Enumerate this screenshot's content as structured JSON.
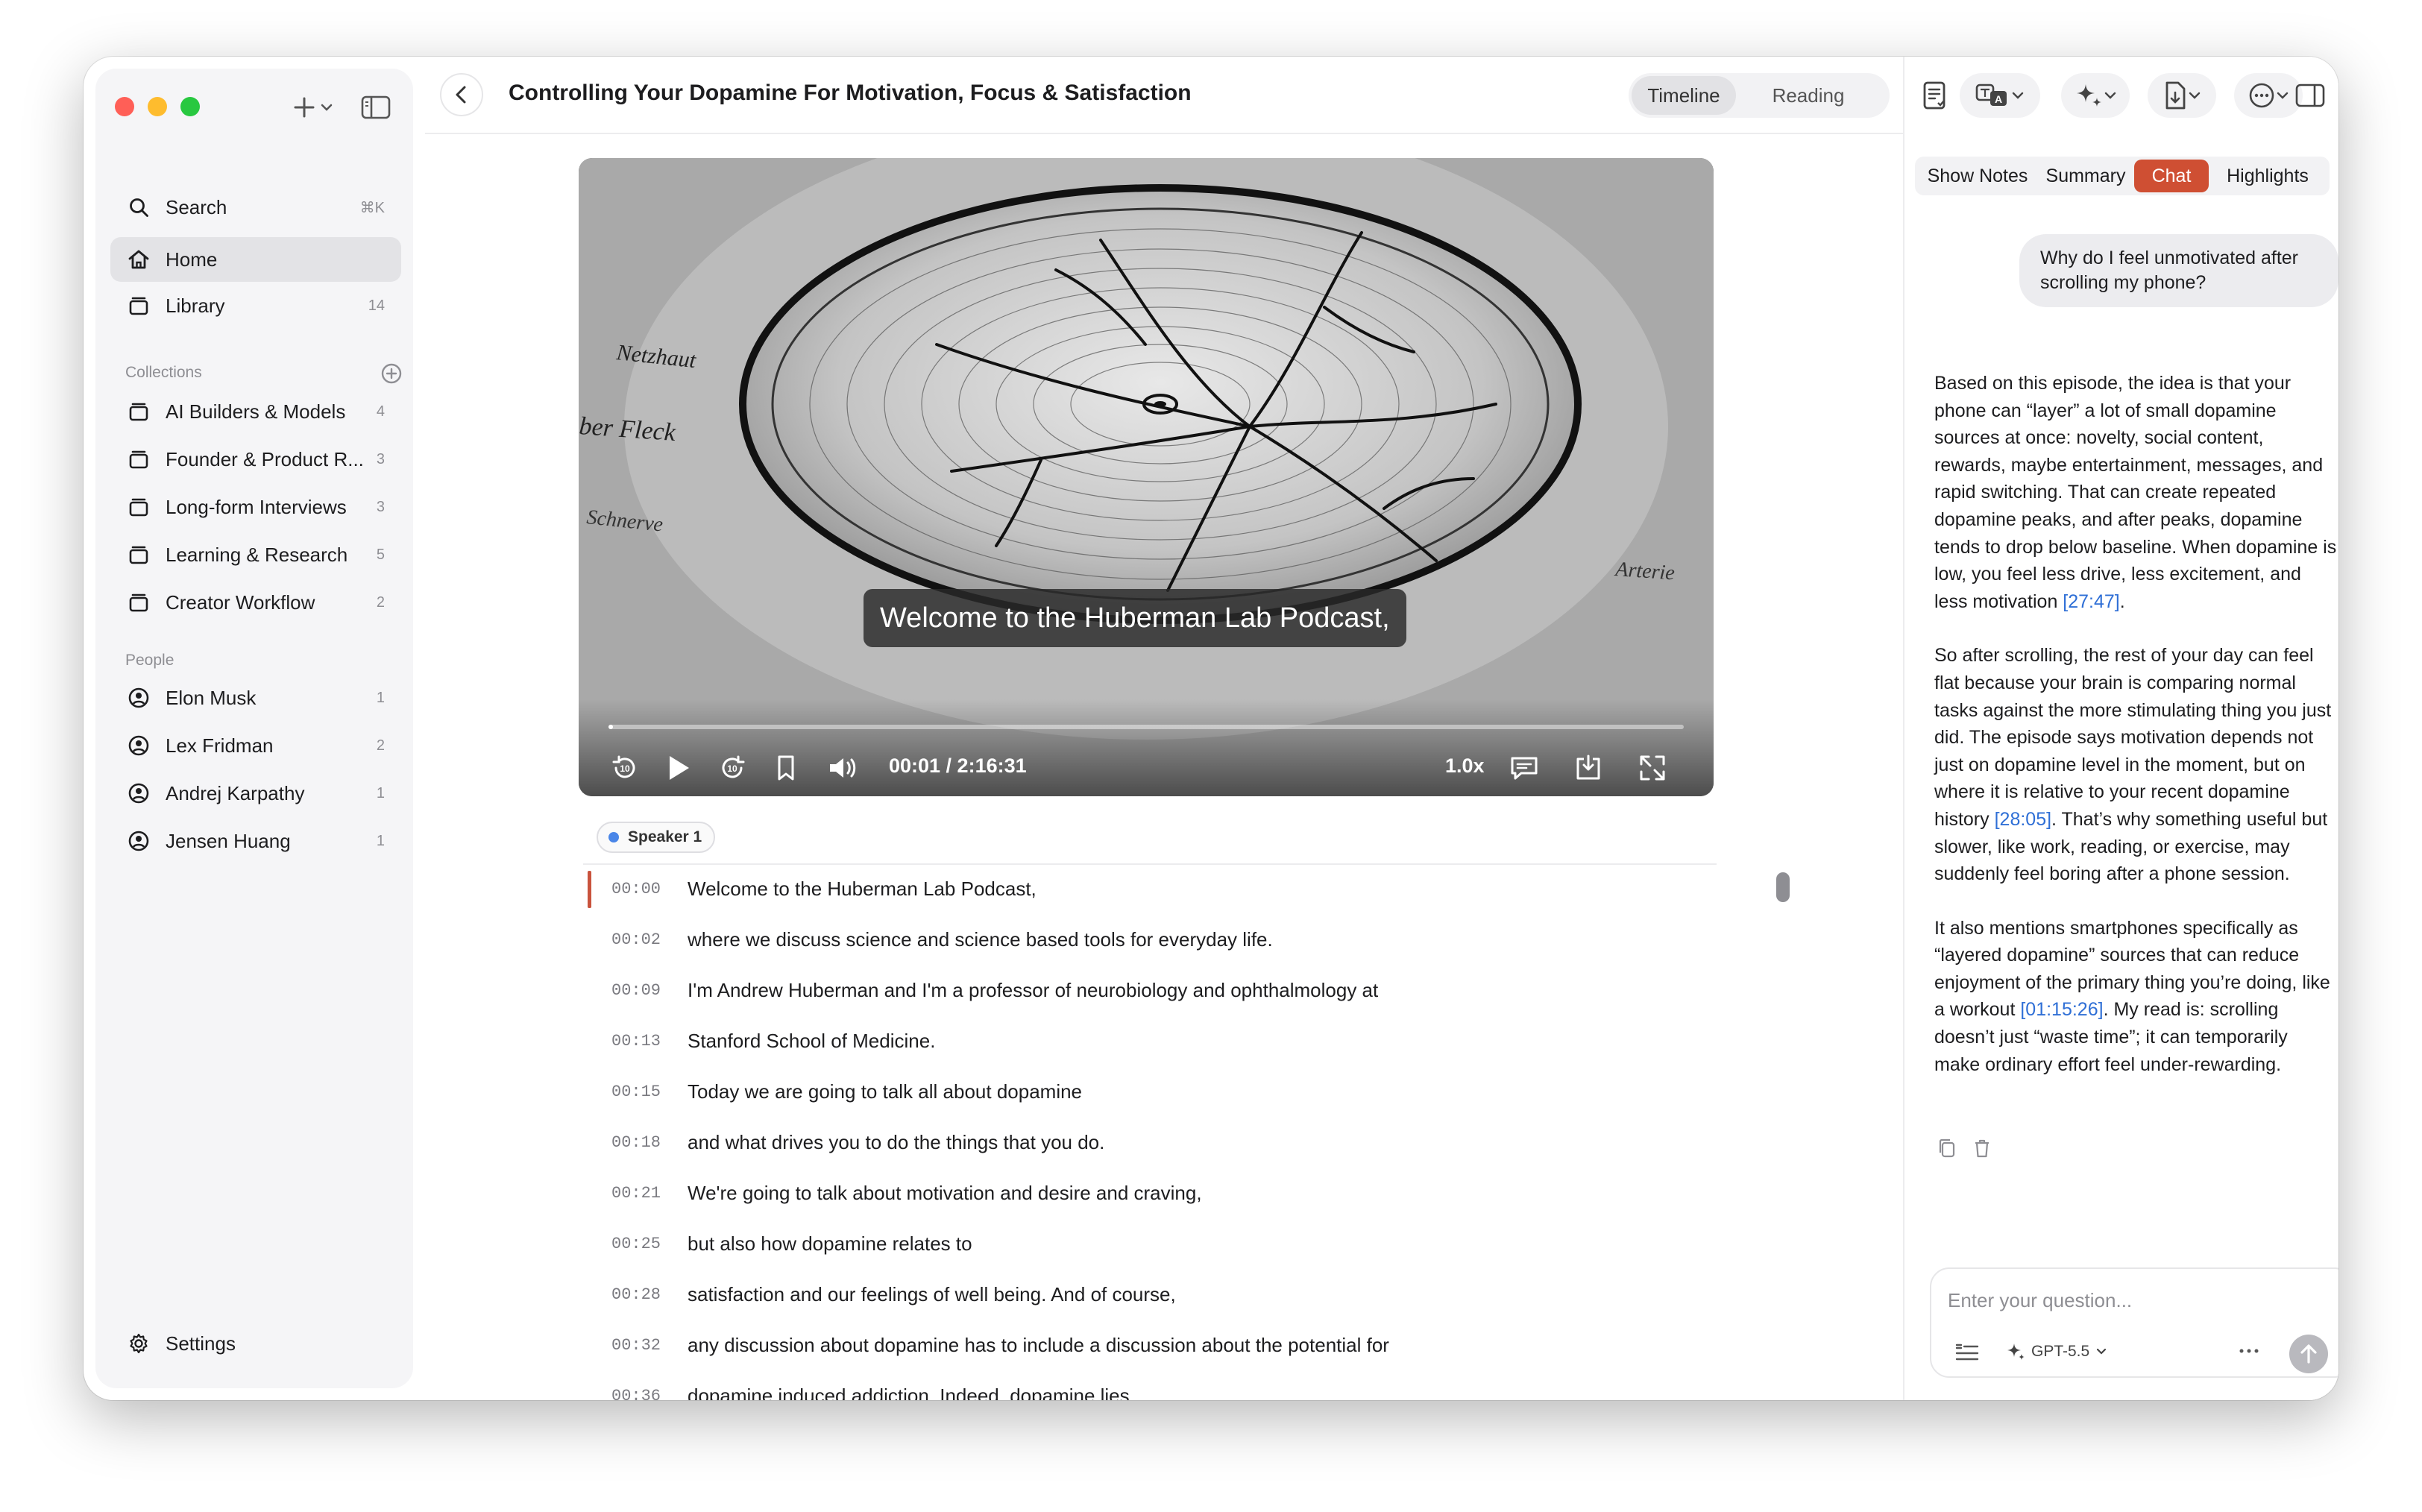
{
  "sidebar": {
    "search_label": "Search",
    "search_shortcut": "⌘K",
    "home_label": "Home",
    "library_label": "Library",
    "library_count": "14",
    "collections_heading": "Collections",
    "collections": [
      {
        "label": "AI Builders & Models",
        "count": "4"
      },
      {
        "label": "Founder & Product R...",
        "count": "3"
      },
      {
        "label": "Long-form Interviews",
        "count": "3"
      },
      {
        "label": "Learning & Research",
        "count": "5"
      },
      {
        "label": "Creator Workflow",
        "count": "2"
      }
    ],
    "people_heading": "People",
    "people": [
      {
        "label": "Elon Musk",
        "count": "1"
      },
      {
        "label": "Lex Fridman",
        "count": "2"
      },
      {
        "label": "Andrej Karpathy",
        "count": "1"
      },
      {
        "label": "Jensen Huang",
        "count": "1"
      }
    ],
    "settings_label": "Settings"
  },
  "header": {
    "title": "Controlling Your Dopamine For Motivation, Focus & Satisfaction",
    "view_tabs": [
      "Timeline",
      "Reading"
    ],
    "active_view": "Timeline"
  },
  "player": {
    "caption": "Welcome to the Huberman Lab Podcast,",
    "time": "00:01 / 2:16:31",
    "speed": "1.0x",
    "progress_fraction": 0.0001
  },
  "speaker_label": "Speaker 1",
  "transcript": [
    {
      "time": "00:00",
      "text": "Welcome to the Huberman Lab Podcast,"
    },
    {
      "time": "00:02",
      "text": "where we discuss science and science based tools for everyday life."
    },
    {
      "time": "00:09",
      "text": "I'm Andrew Huberman and I'm a professor of neurobiology and ophthalmology at"
    },
    {
      "time": "00:13",
      "text": "Stanford School of Medicine."
    },
    {
      "time": "00:15",
      "text": "Today we are going to talk all about dopamine"
    },
    {
      "time": "00:18",
      "text": "and what drives you to do the things that you do."
    },
    {
      "time": "00:21",
      "text": "We're going to talk about motivation and desire and craving,"
    },
    {
      "time": "00:25",
      "text": "but also how dopamine relates to"
    },
    {
      "time": "00:28",
      "text": "satisfaction and our feelings of well being. And of course,"
    },
    {
      "time": "00:32",
      "text": "any discussion about dopamine has to include a discussion about the potential for"
    },
    {
      "time": "00:36",
      "text": "dopamine induced addiction. Indeed, dopamine lies"
    }
  ],
  "right_panel": {
    "tabs": [
      "Show Notes",
      "Summary",
      "Chat",
      "Highlights"
    ],
    "active_tab": "Chat",
    "user_question": "Why do I feel unmotivated after scrolling my phone?",
    "answer_paragraphs": [
      {
        "text": "Based on this episode, the idea is that your phone can “layer” a lot of small dopamine sources at once: novelty, social content, rewards, maybe entertainment, messages, and rapid switching. That can create repeated dopamine peaks, and after peaks, dopamine tends to drop below baseline. When dopamine is low, you feel less drive, less excitement, and less motivation ",
        "link": "[27:47]",
        "tail": "."
      },
      {
        "text": "So after scrolling, the rest of your day can feel flat because your brain is comparing normal tasks against the more stimulating thing you just did. The episode says motivation depends not just on dopamine level in the moment, but on where it is relative to your recent dopamine history ",
        "link": "[28:05]",
        "tail": ". That’s why something useful but slower, like work, reading, or exercise, may suddenly feel boring after a phone session."
      },
      {
        "text": "It also mentions smartphones specifically as “layered dopamine” sources that can reduce enjoyment of the primary thing you’re doing, like a workout ",
        "link": "[01:15:26]",
        "tail": ". My read is: scrolling doesn’t just “waste time”; it can temporarily make ordinary effort feel under-rewarding."
      }
    ],
    "input_placeholder": "Enter your question...",
    "model_label": "GPT-5.5"
  },
  "colors": {
    "accent": "#cf4f33",
    "link": "#2f6fd6",
    "speaker_dot": "#4a86e8"
  }
}
